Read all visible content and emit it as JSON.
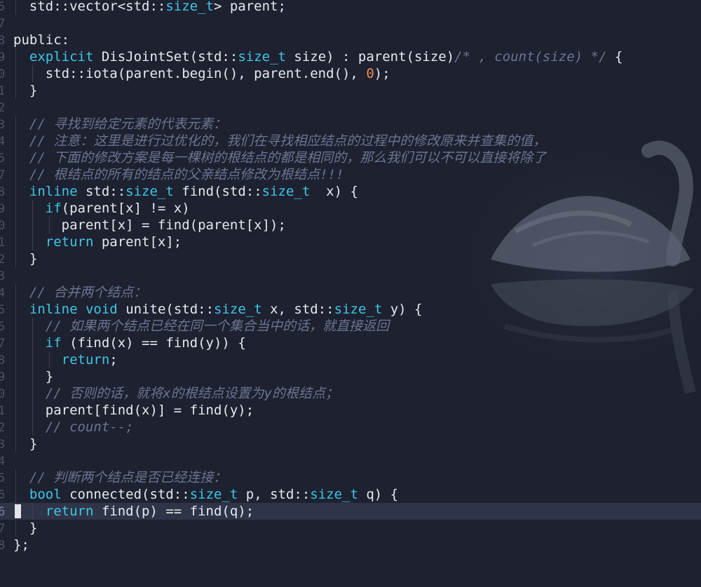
{
  "editor": {
    "current_line_number": "6",
    "gutter": [
      "5",
      "7",
      "8",
      "9",
      "0",
      "1",
      "2",
      "3",
      "4",
      "5",
      "7",
      "8",
      "9",
      "0",
      "1",
      "2",
      "3",
      "4",
      "5",
      "5",
      "7",
      "8",
      "9",
      "0",
      "1",
      "2",
      "3",
      "4",
      "5",
      "6",
      "7",
      "8"
    ],
    "lines": {
      "l01": {
        "a": "  std::vector<std::",
        "b": "size_t",
        "c": "> parent;"
      },
      "l03": {
        "a": "public:"
      },
      "l04": {
        "a": "  ",
        "b": "explicit",
        "c": " DisJointSet(std::",
        "d": "size_t",
        "e": " size) : parent(size)",
        "f": "/* , count(size) */",
        "g": " {"
      },
      "l05": {
        "a": "    std::iota(parent.begin(), parent.end(), ",
        "b": "0",
        "c": ");"
      },
      "l06": {
        "a": "  }"
      },
      "l08": {
        "a": "  // 寻找到给定元素的代表元素："
      },
      "l09": {
        "a": "  // 注意：这里是进行过优化的，我们在寻找相应结点的过程中的修改原来并查集的值，"
      },
      "l10": {
        "a": "  // 下面的修改方案是每一棵树的根结点的都是相同的，那么我们可以不可以直接将除了"
      },
      "l11": {
        "a": "  // 根结点的所有的结点的父亲结点修改为根结点!!!"
      },
      "l12": {
        "a": "  ",
        "b": "inline",
        "c": " std::",
        "d": "size_t",
        "e": " find(std::",
        "f": "size_t",
        "g": "  x) {"
      },
      "l13": {
        "a": "    ",
        "b": "if",
        "c": "(parent[x] != x)"
      },
      "l14": {
        "a": "      parent[x] = find(parent[x]);"
      },
      "l15": {
        "a": "    ",
        "b": "return",
        "c": " parent[x];"
      },
      "l16": {
        "a": "  }"
      },
      "l18": {
        "a": "  // 合并两个结点："
      },
      "l19": {
        "a": "  ",
        "b": "inline",
        "c": " ",
        "d": "void",
        "e": " unite(std::",
        "f": "size_t",
        "g": " x, std::",
        "h": "size_t",
        "i": " y) {"
      },
      "l20": {
        "a": "    // 如果两个结点已经在同一个集合当中的话，就直接返回"
      },
      "l21": {
        "a": "    ",
        "b": "if",
        "c": " (find(x) == find(y)) {"
      },
      "l22": {
        "a": "      ",
        "b": "return",
        "c": ";"
      },
      "l23": {
        "a": "    }"
      },
      "l24": {
        "a": "    // 否则的话，就将x的根结点设置为y的根结点；"
      },
      "l25": {
        "a": "    parent[find(x)] = find(y);"
      },
      "l26": {
        "a": "    // count--;"
      },
      "l27": {
        "a": "  }"
      },
      "l29": {
        "a": "  // 判断两个结点是否已经连接："
      },
      "l30": {
        "a": "  ",
        "b": "bool",
        "c": " connected(std::",
        "d": "size_t",
        "e": " p, std::",
        "f": "size_t",
        "g": " q) {"
      },
      "l31": {
        "a": "    ",
        "b": "return",
        "c": " find(p) == find(q);"
      },
      "l32": {
        "a": "  }"
      },
      "l33": {
        "a": "};"
      }
    }
  },
  "colors": {
    "background": "#1d2130",
    "keyword": "#3ec7e6",
    "comment": "#6c7591",
    "number": "#f08a4c",
    "text": "#e7e9ee"
  },
  "background_art": "swan-silhouette"
}
